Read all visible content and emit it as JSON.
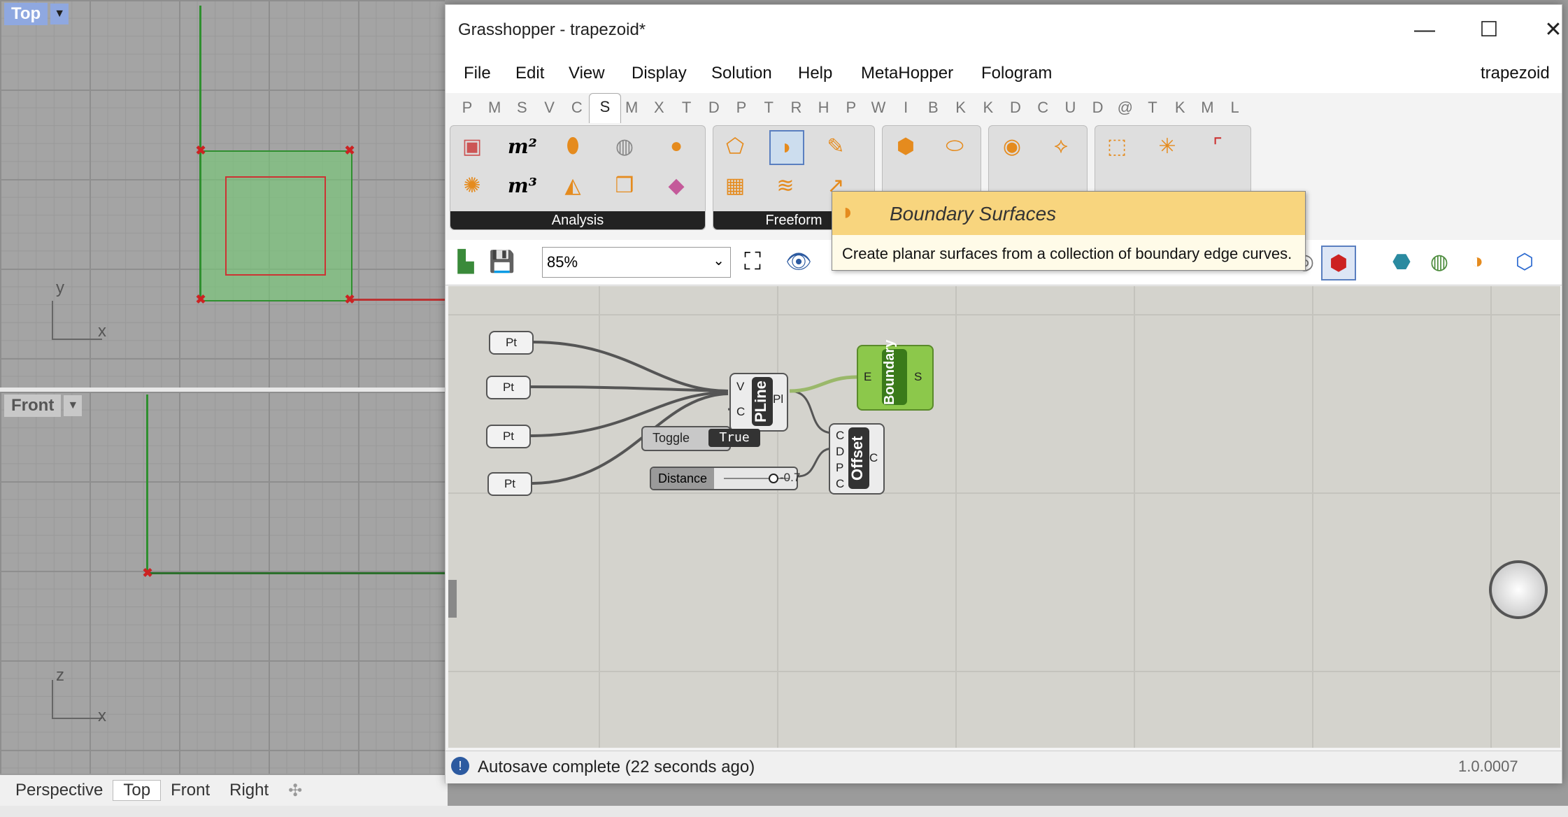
{
  "rhino": {
    "top_viewport": {
      "label": "Top",
      "axis_y": "y",
      "axis_x": "x"
    },
    "front_viewport": {
      "label": "Front",
      "axis_y": "z",
      "axis_x": "x"
    },
    "viewport_tabs": [
      "Perspective",
      "Top",
      "Front",
      "Right"
    ],
    "add_tab_icon": "plus-icon"
  },
  "grasshopper": {
    "title": "Grasshopper - trapezoid*",
    "menu": [
      "File",
      "Edit",
      "View",
      "Display",
      "Solution",
      "Help",
      "MetaHopper",
      "Fologram"
    ],
    "document_name": "trapezoid",
    "tabs": [
      "P",
      "M",
      "S",
      "V",
      "C",
      "S",
      "M",
      "X",
      "T",
      "D",
      "P",
      "T",
      "R",
      "H",
      "P",
      "W",
      "I",
      "B",
      "K",
      "K",
      "D",
      "C",
      "U",
      "D",
      "@",
      "T",
      "K",
      "M",
      "L"
    ],
    "active_tab_index": 5,
    "ribbon_groups": [
      "Analysis",
      "Freeform"
    ],
    "zoom": "85%",
    "tooltip": {
      "title": "Boundary Surfaces",
      "description": "Create planar surfaces from a collection of boundary edge curves."
    },
    "components": {
      "pt_label": "Pt",
      "pline": {
        "name": "PLine",
        "inputs": [
          "V",
          "C"
        ],
        "output": "Pl"
      },
      "boundary": {
        "name": "Boundary",
        "input": "E",
        "output": "S"
      },
      "offset": {
        "name": "Offset",
        "inputs": [
          "C",
          "D",
          "P",
          "C"
        ],
        "output": "C"
      },
      "toggle": {
        "label": "Toggle",
        "value": "True"
      },
      "distance": {
        "label": "Distance",
        "value": "-0.7"
      }
    },
    "status": {
      "message": "Autosave complete (22 seconds ago)",
      "version": "1.0.0007"
    }
  }
}
